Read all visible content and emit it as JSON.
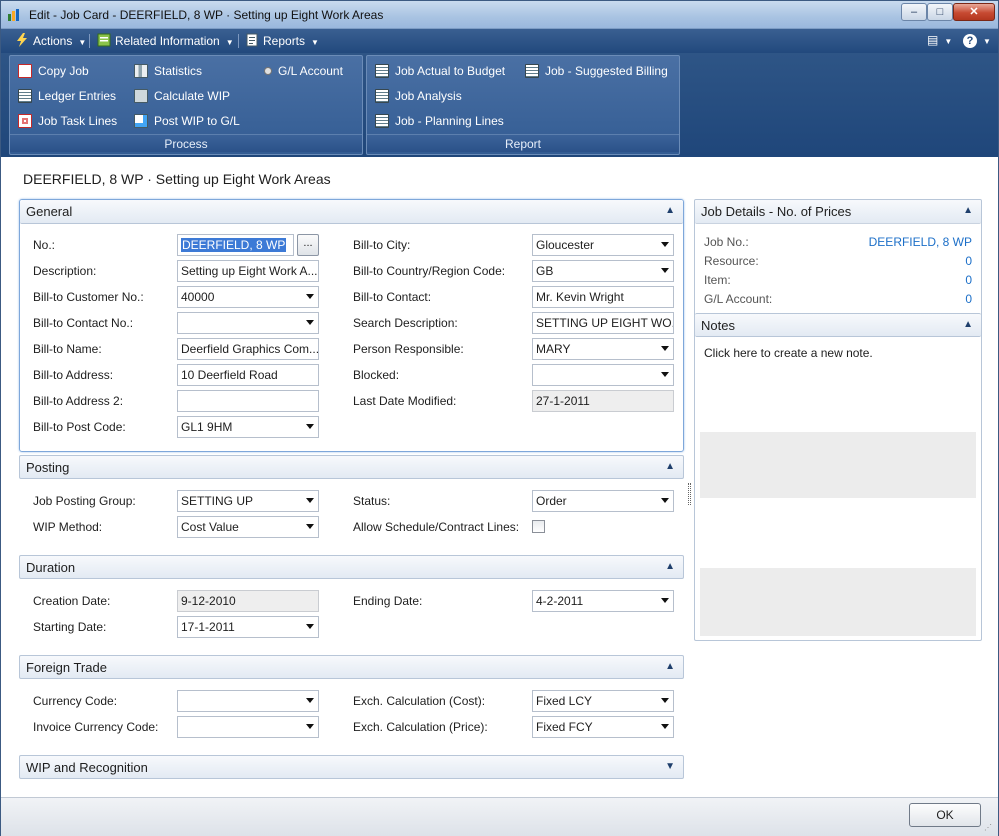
{
  "window": {
    "title": "Edit - Job Card - DEERFIELD, 8 WP · Setting up Eight Work Areas",
    "min_label": "–",
    "max_label": "□",
    "close_label": "✕"
  },
  "menubar": {
    "items": [
      {
        "label": "Actions",
        "icon": "lightning-icon"
      },
      {
        "label": "Related Information",
        "icon": "related-info-icon"
      },
      {
        "label": "Reports",
        "icon": "reports-icon"
      }
    ],
    "layout_glyph": "▤",
    "help_glyph": "?"
  },
  "ribbon": {
    "process": {
      "label": "Process",
      "buttons": [
        {
          "label": "Copy Job",
          "icon": "copy-job-icon"
        },
        {
          "label": "Ledger Entries",
          "icon": "ledger-entries-icon"
        },
        {
          "label": "Job Task Lines",
          "icon": "job-task-lines-icon"
        },
        {
          "label": "Statistics",
          "icon": "statistics-icon"
        },
        {
          "label": "Calculate WIP",
          "icon": "calculate-wip-icon"
        },
        {
          "label": "Post WIP to G/L",
          "icon": "post-wip-icon"
        },
        {
          "label": "G/L Account",
          "icon": "gl-account-icon"
        }
      ]
    },
    "report": {
      "label": "Report",
      "buttons": [
        {
          "label": "Job Actual to Budget",
          "icon": "report-icon"
        },
        {
          "label": "Job Analysis",
          "icon": "report-icon"
        },
        {
          "label": "Job - Planning Lines",
          "icon": "report-icon"
        },
        {
          "label": "Job - Suggested Billing",
          "icon": "report-icon"
        }
      ]
    }
  },
  "page": {
    "title": "DEERFIELD, 8 WP · Setting up Eight Work Areas"
  },
  "general": {
    "title": "General",
    "no_label": "No.:",
    "no_value": "DEERFIELD, 8 WP",
    "assist_label": "...",
    "description_label": "Description:",
    "description_value": "Setting up Eight Work A...",
    "bill_to_customer_no_label": "Bill-to Customer No.:",
    "bill_to_customer_no_value": "40000",
    "bill_to_contact_no_label": "Bill-to Contact No.:",
    "bill_to_contact_no_value": "",
    "bill_to_name_label": "Bill-to Name:",
    "bill_to_name_value": "Deerfield Graphics Com...",
    "bill_to_address_label": "Bill-to Address:",
    "bill_to_address_value": "10 Deerfield Road",
    "bill_to_address2_label": "Bill-to Address 2:",
    "bill_to_address2_value": "",
    "bill_to_post_code_label": "Bill-to Post Code:",
    "bill_to_post_code_value": "GL1 9HM",
    "bill_to_city_label": "Bill-to City:",
    "bill_to_city_value": "Gloucester",
    "bill_to_country_label": "Bill-to Country/Region Code:",
    "bill_to_country_value": "GB",
    "bill_to_contact_label": "Bill-to Contact:",
    "bill_to_contact_value": "Mr. Kevin Wright",
    "search_description_label": "Search Description:",
    "search_description_value": "SETTING UP EIGHT WO...",
    "person_responsible_label": "Person Responsible:",
    "person_responsible_value": "MARY",
    "blocked_label": "Blocked:",
    "blocked_value": "",
    "last_date_modified_label": "Last Date Modified:",
    "last_date_modified_value": "27-1-2011"
  },
  "posting": {
    "title": "Posting",
    "job_posting_group_label": "Job Posting Group:",
    "job_posting_group_value": "SETTING UP",
    "wip_method_label": "WIP Method:",
    "wip_method_value": "Cost Value",
    "status_label": "Status:",
    "status_value": "Order",
    "allow_schedule_label": "Allow Schedule/Contract Lines:"
  },
  "duration": {
    "title": "Duration",
    "creation_date_label": "Creation Date:",
    "creation_date_value": "9-12-2010",
    "starting_date_label": "Starting Date:",
    "starting_date_value": "17-1-2011",
    "ending_date_label": "Ending Date:",
    "ending_date_value": "4-2-2011"
  },
  "foreign_trade": {
    "title": "Foreign Trade",
    "currency_code_label": "Currency Code:",
    "currency_code_value": "",
    "invoice_currency_code_label": "Invoice Currency Code:",
    "invoice_currency_code_value": "",
    "exch_cost_label": "Exch. Calculation (Cost):",
    "exch_cost_value": "Fixed LCY",
    "exch_price_label": "Exch. Calculation (Price):",
    "exch_price_value": "Fixed FCY"
  },
  "wip": {
    "title": "WIP and Recognition"
  },
  "factbox": {
    "job_details_title": "Job Details - No. of Prices",
    "rows": [
      {
        "label": "Job No.:",
        "value": "DEERFIELD, 8 WP"
      },
      {
        "label": "Resource:",
        "value": "0"
      },
      {
        "label": "Item:",
        "value": "0"
      },
      {
        "label": "G/L Account:",
        "value": "0"
      }
    ],
    "notes_title": "Notes",
    "notes_text": "Click here to create a new note."
  },
  "footer": {
    "ok_label": "OK"
  },
  "colors": {
    "menubar": "#22497d",
    "ribbon": "#335c93",
    "link": "#1c6fc8",
    "selection": "#3d7ad6"
  }
}
